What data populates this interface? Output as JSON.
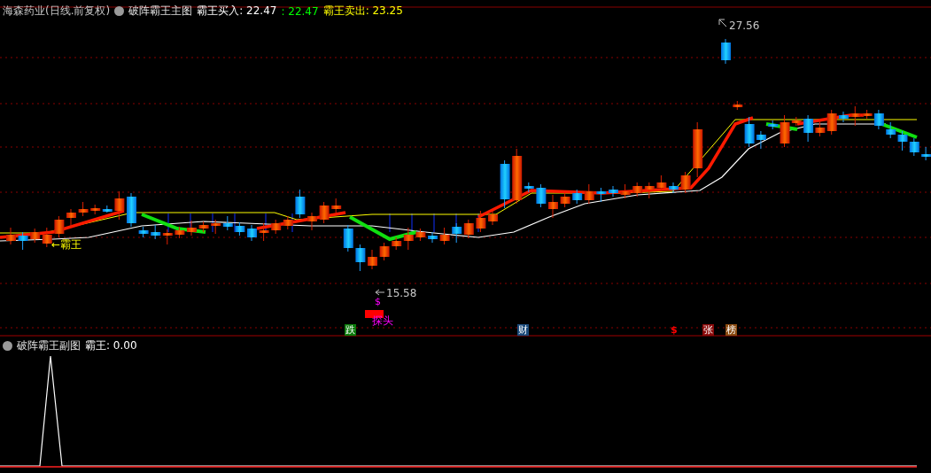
{
  "main_chart": {
    "title": "海森药业(日线.前复权)",
    "indicator": "破阵霸王主图",
    "legend": [
      {
        "text": "霸王买入: 22.47",
        "color": "#ffffff"
      },
      {
        "text": ": 22.47",
        "color": "#00ff00"
      },
      {
        "text": "霸王卖出: 23.25",
        "color": "#ffff00"
      }
    ],
    "high_label": "27.56",
    "low_label": "15.58",
    "line_label": "←霸王",
    "low_mark": "$",
    "probe_label": "探头",
    "markers": [
      {
        "text": "跌",
        "kind": "badge",
        "color": "#0a7a0a"
      },
      {
        "text": "财",
        "kind": "badge",
        "color": "#1b4a7a"
      },
      {
        "text": "$",
        "kind": "glyph",
        "color": "#ff0000"
      },
      {
        "text": "张",
        "kind": "badge",
        "color": "#8a0a0a"
      },
      {
        "text": "榜",
        "kind": "badge",
        "color": "#8a4a10"
      }
    ]
  },
  "sub_chart": {
    "indicator": "破阵霸王副图",
    "legend": "霸王: 0.00"
  }
}
